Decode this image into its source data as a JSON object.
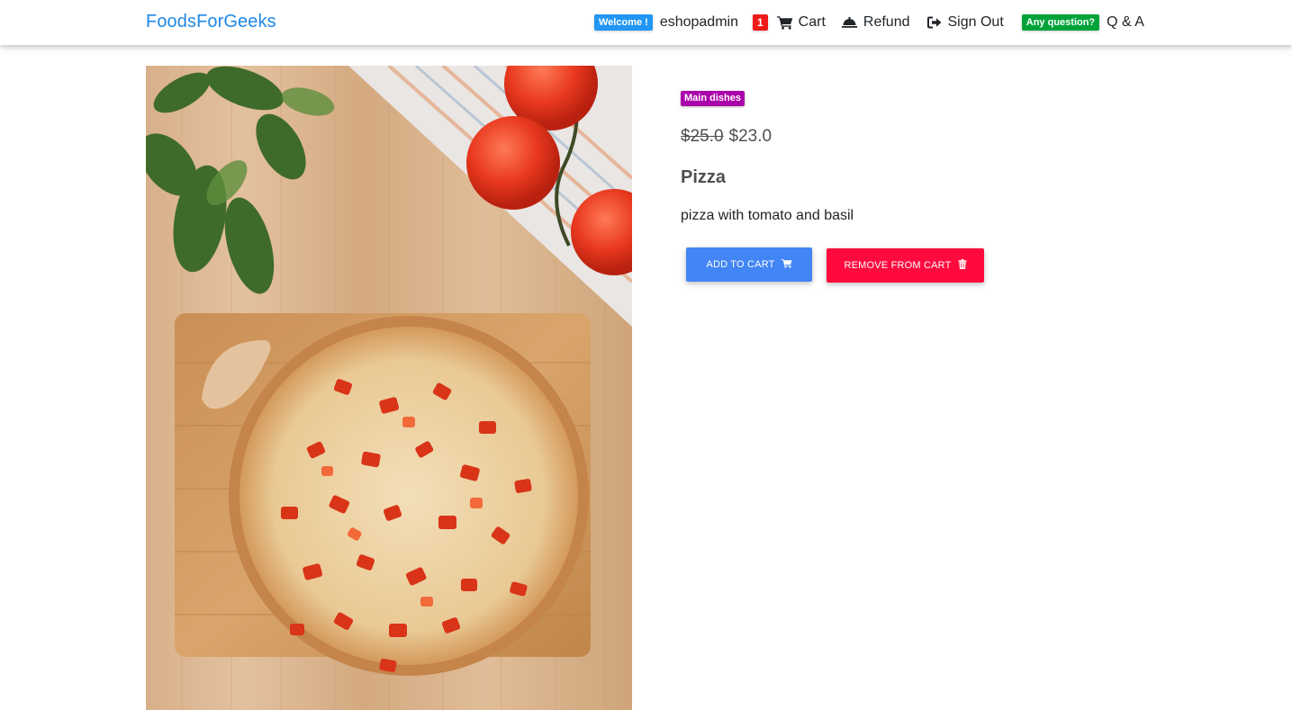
{
  "navbar": {
    "brand": "FoodsForGeeks",
    "welcome_badge": "Welcome !",
    "username": "eshopadmin",
    "cart_count": "1",
    "cart_label": "Cart",
    "refund_label": "Refund",
    "signout_label": "Sign Out",
    "question_badge": "Any question?",
    "qa_label": "Q & A"
  },
  "product": {
    "category": "Main dishes",
    "old_price": "$25.0",
    "new_price": "$23.0",
    "title": "Pizza",
    "description": "pizza with tomato and basil",
    "add_button": "ADD TO CART",
    "remove_button": "REMOVE FROM CART"
  },
  "icons": {
    "cart": "cart-icon",
    "refund": "serving-dish-icon",
    "signout": "sign-out-icon",
    "trash": "trash-icon"
  },
  "colors": {
    "brand": "#1e88e5",
    "welcome_badge": "#2196f3",
    "cart_count_badge": "#f01818",
    "question_badge": "#00a339",
    "category_badge": "#aa00aa",
    "add_button": "#4285f4",
    "remove_button": "#ff0a3f"
  }
}
